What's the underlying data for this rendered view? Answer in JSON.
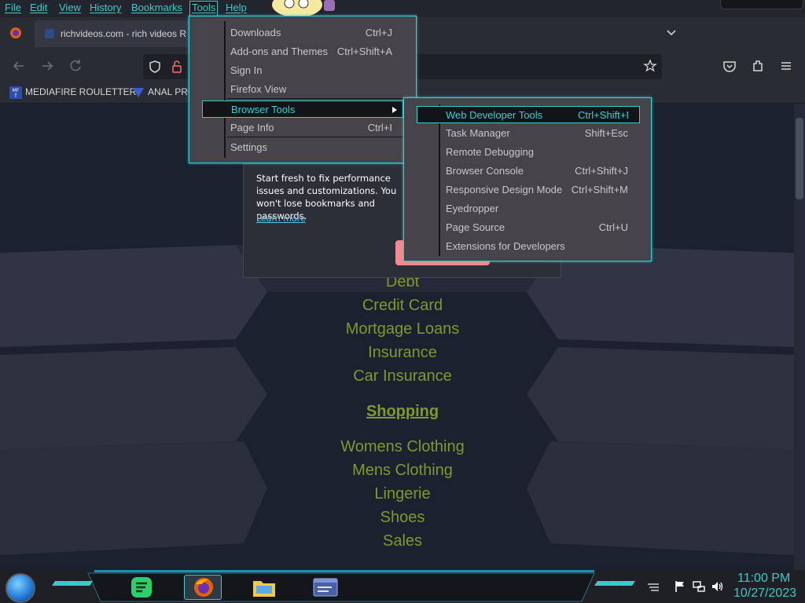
{
  "menubar": {
    "items": [
      {
        "label": "File"
      },
      {
        "label": "Edit"
      },
      {
        "label": "View"
      },
      {
        "label": "History"
      },
      {
        "label": "Bookmarks"
      },
      {
        "label": "Tools"
      },
      {
        "label": "Help"
      }
    ],
    "active": "Tools"
  },
  "tabs": {
    "active_title": "richvideos.com - rich videos R"
  },
  "bookmarks": [
    {
      "label": "MEDIAFIRE ROULETTER"
    },
    {
      "label": "ANAL PRO"
    }
  ],
  "page": {
    "links_top": [
      "Debt",
      "Credit Card",
      "Mortgage Loans",
      "Insurance",
      "Car Insurance"
    ],
    "shopping_heading": "Shopping",
    "links_bottom": [
      "Womens Clothing",
      "Mens Clothing",
      "Lingerie",
      "Shoes",
      "Sales"
    ]
  },
  "reset_panel": {
    "text": "Start fresh to fix performance issues and customizations. You won't lose bookmarks and passwords.",
    "learn_more": "Learn more"
  },
  "tools_menu": {
    "items": [
      {
        "label": "Downloads",
        "shortcut": "Ctrl+J"
      },
      {
        "label": "Add-ons and Themes",
        "shortcut": "Ctrl+Shift+A"
      },
      {
        "label": "Sign In",
        "shortcut": ""
      },
      {
        "label": "Firefox View",
        "shortcut": ""
      },
      {
        "label": "Browser Tools",
        "shortcut": ""
      },
      {
        "label": "Page Info",
        "shortcut": "Ctrl+I"
      },
      {
        "label": "Settings",
        "shortcut": ""
      }
    ],
    "highlighted": "Browser Tools"
  },
  "browser_tools_submenu": {
    "items": [
      {
        "label": "Web Developer Tools",
        "shortcut": "Ctrl+Shift+I"
      },
      {
        "label": "Task Manager",
        "shortcut": "Shift+Esc"
      },
      {
        "label": "Remote Debugging",
        "shortcut": ""
      },
      {
        "label": "Browser Console",
        "shortcut": "Ctrl+Shift+J"
      },
      {
        "label": "Responsive Design Mode",
        "shortcut": "Ctrl+Shift+M"
      },
      {
        "label": "Eyedropper",
        "shortcut": ""
      },
      {
        "label": "Page Source",
        "shortcut": "Ctrl+U"
      },
      {
        "label": "Extensions for Developers",
        "shortcut": ""
      }
    ],
    "highlighted": "Web Developer Tools"
  },
  "taskbar": {
    "clock_time": "11:00 PM",
    "clock_date": "10/27/2023"
  },
  "colors": {
    "accent": "#3ec9c9",
    "link": "#7d9a2a",
    "page_bg": "#1c2130",
    "menu_bg": "#47434a",
    "reset_button": "#ff848b"
  }
}
